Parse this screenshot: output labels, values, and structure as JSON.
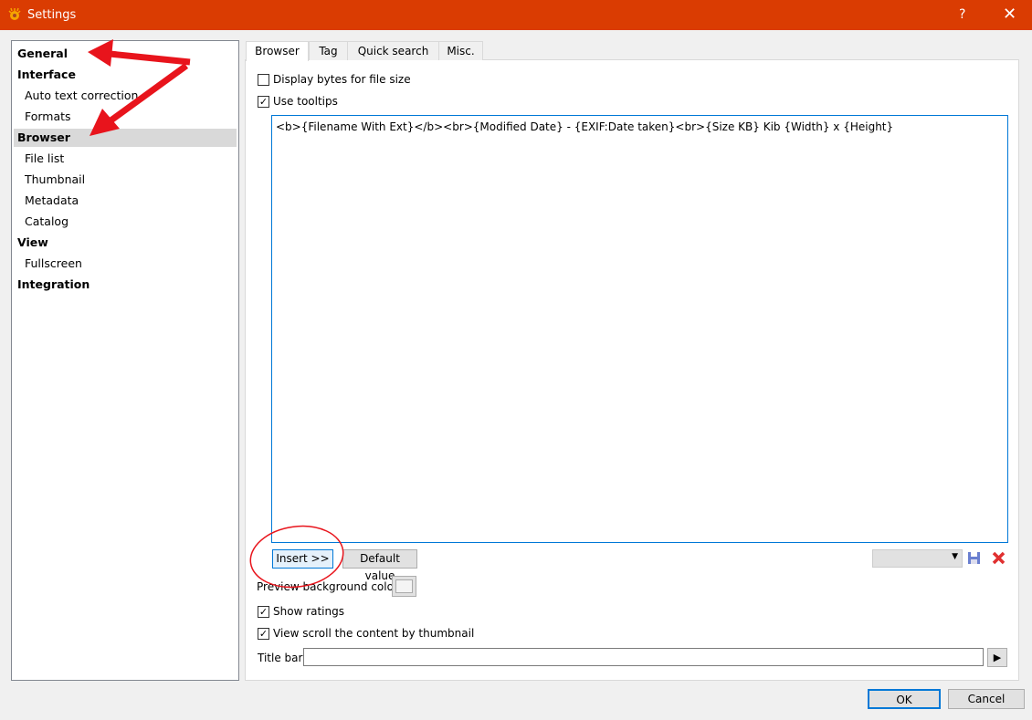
{
  "window": {
    "title": "Settings",
    "help": "?",
    "close": "✕"
  },
  "tree": [
    {
      "label": "General",
      "level": 0
    },
    {
      "label": "Interface",
      "level": 0
    },
    {
      "label": "Auto text correction",
      "level": 1
    },
    {
      "label": "Formats",
      "level": 1
    },
    {
      "label": "Browser",
      "level": 0,
      "selected": true
    },
    {
      "label": "File list",
      "level": 1
    },
    {
      "label": "Thumbnail",
      "level": 1
    },
    {
      "label": "Metadata",
      "level": 1
    },
    {
      "label": "Catalog",
      "level": 1
    },
    {
      "label": "View",
      "level": 0
    },
    {
      "label": "Fullscreen",
      "level": 1
    },
    {
      "label": "Integration",
      "level": 0
    }
  ],
  "tabs": [
    "Browser",
    "Tag",
    "Quick search",
    "Misc."
  ],
  "browser": {
    "display_bytes": {
      "label": "Display bytes for file size",
      "checked": false
    },
    "use_tooltips": {
      "label": "Use tooltips",
      "checked": true
    },
    "tooltip_template": "<b>{Filename With Ext}</b><br>{Modified Date} - {EXIF:Date taken}<br>{Size KB} Kib {Width} x {Height}",
    "insert": "Insert >>",
    "default_value": "Default value",
    "preview_bg": "Preview background color",
    "show_ratings": {
      "label": "Show ratings",
      "checked": true
    },
    "view_scroll": {
      "label": "View scroll the content by thumbnail",
      "checked": true
    },
    "title_bar": {
      "label": "Title bar",
      "value": ""
    }
  },
  "footer": {
    "ok": "OK",
    "cancel": "Cancel"
  },
  "colors": {
    "titlebar": "#da3c02",
    "accent": "#0078d7",
    "annotation": "#e8141c"
  }
}
